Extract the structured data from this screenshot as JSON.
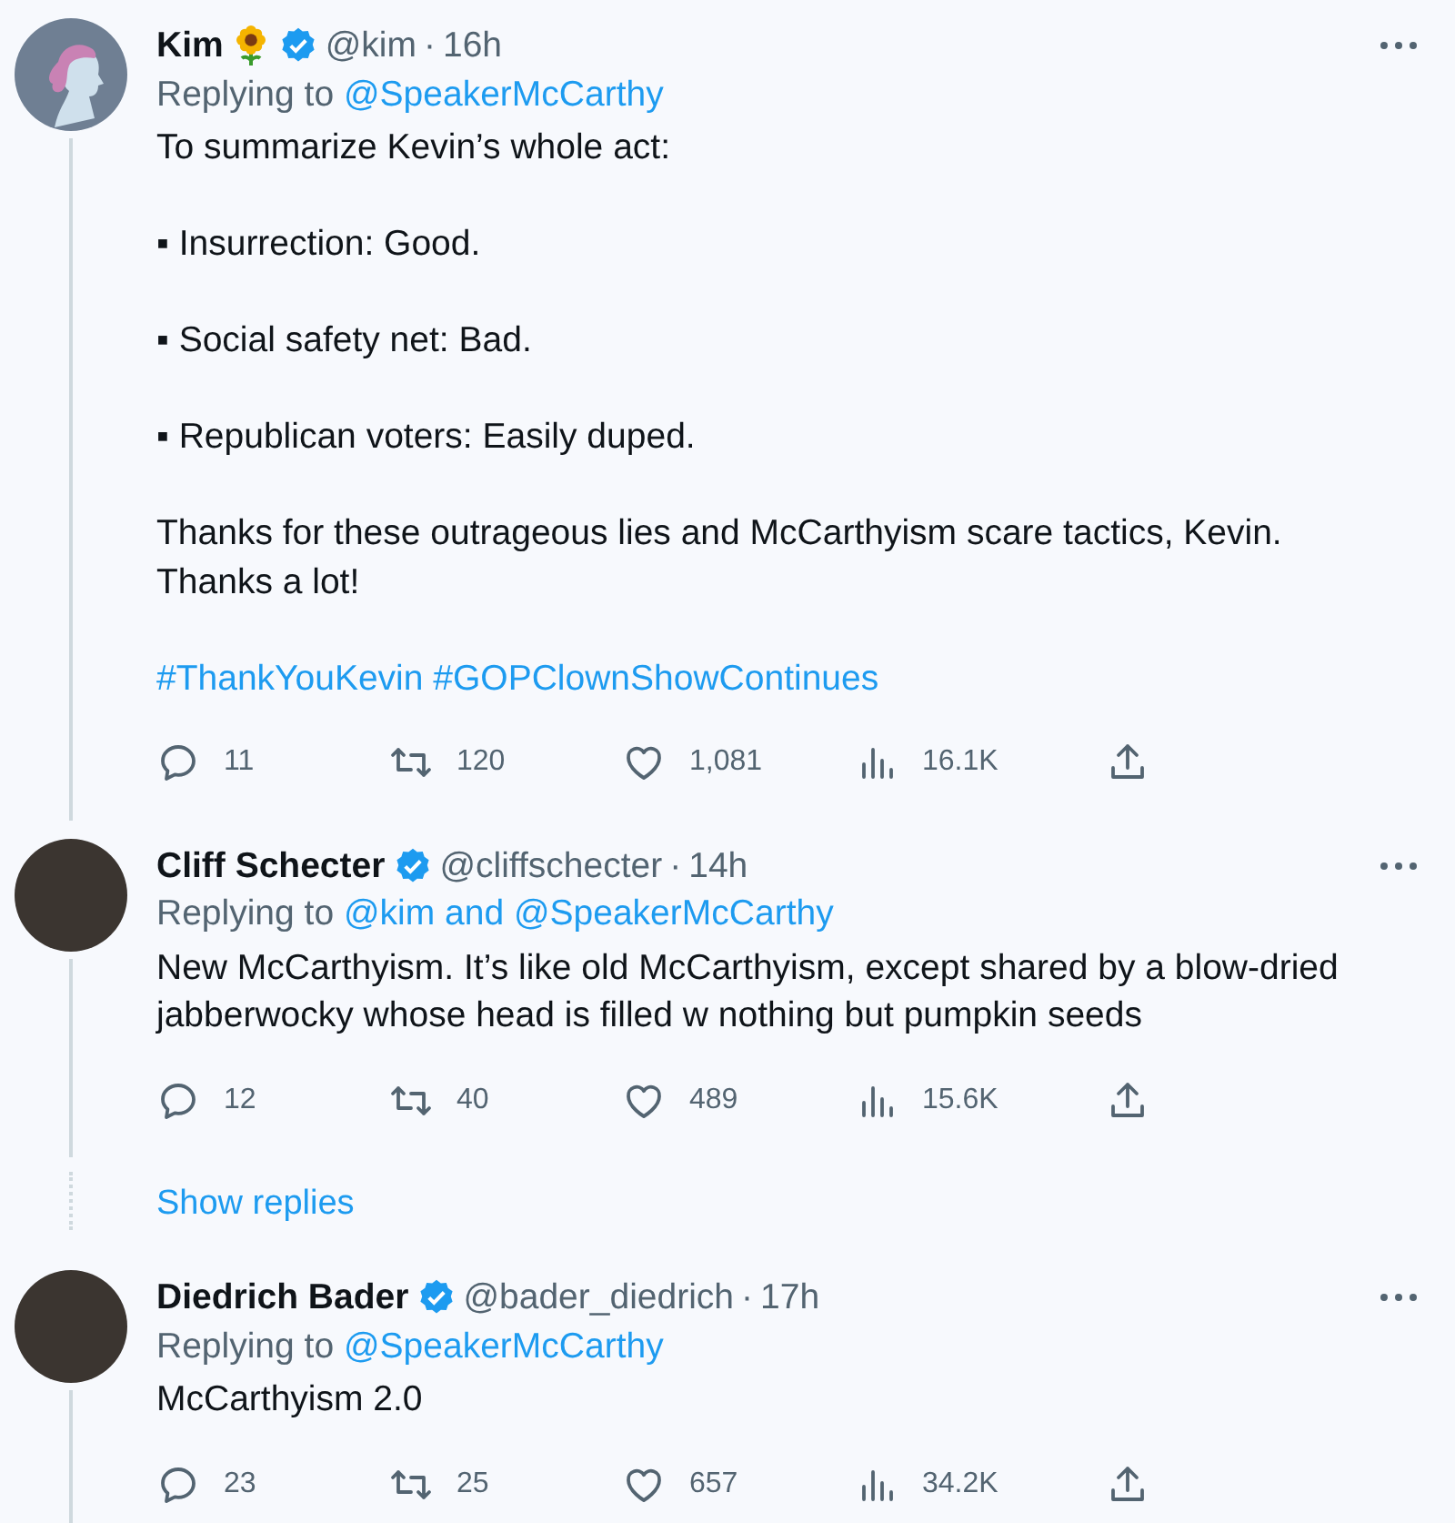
{
  "thread": [
    {
      "kind": "tweet",
      "avatar": {
        "kind": "drawing"
      },
      "name": "Kim",
      "handle": "@kim",
      "separator": "·",
      "time": "16h",
      "replying": {
        "prefix": "Replying to",
        "target": "@SpeakerMcCarthy"
      },
      "body": [
        "To summarize Kevin’s whole act:",
        "▪ Insurrection: Good.",
        "▪ Social safety net: Bad.",
        "▪ Republican voters: Easily duped.",
        "Thanks for these outrageous lies and McCarthyism scare tactics, Kevin. Thanks a lot!"
      ],
      "hashtags": [
        "#ThankYouKevin",
        "#GOPClownShowContinues"
      ],
      "actions": [
        {
          "kind": "reply",
          "count": "11"
        },
        {
          "kind": "retweet",
          "count": "120"
        },
        {
          "kind": "like",
          "count": "1,081"
        },
        {
          "kind": "views",
          "count": "16.1K"
        },
        {
          "kind": "share"
        }
      ]
    },
    {
      "kind": "tweet",
      "avatar": {
        "kind": "photo"
      },
      "name": "Cliff Schecter",
      "handle": "@cliffschecter",
      "separator": "·",
      "time": "14h",
      "replying": {
        "prefix": "Replying to",
        "target": "@kim and @SpeakerMcCarthy"
      },
      "body": [
        "New McCarthyism. It’s like old McCarthyism, except shared by a blow-dried jabberwocky whose head is filled w nothing but pumpkin seeds"
      ],
      "actions": [
        {
          "kind": "reply",
          "count": "12"
        },
        {
          "kind": "retweet",
          "count": "40"
        },
        {
          "kind": "like",
          "count": "489"
        },
        {
          "kind": "views",
          "count": "15.6K"
        },
        {
          "kind": "share"
        }
      ]
    },
    {
      "kind": "show_replies",
      "label": "Show replies"
    },
    {
      "kind": "tweet",
      "avatar": {
        "kind": "photo"
      },
      "name": "Diedrich Bader",
      "handle": "@bader_diedrich",
      "separator": "·",
      "time": "17h",
      "replying": {
        "prefix": "Replying to",
        "target": "@SpeakerMcCarthy"
      },
      "body": [
        "McCarthyism 2.0"
      ],
      "actions": [
        {
          "kind": "reply",
          "count": "23"
        },
        {
          "kind": "retweet",
          "count": "25"
        },
        {
          "kind": "like",
          "count": "657"
        },
        {
          "kind": "views",
          "count": "34.2K"
        },
        {
          "kind": "share"
        }
      ]
    }
  ]
}
